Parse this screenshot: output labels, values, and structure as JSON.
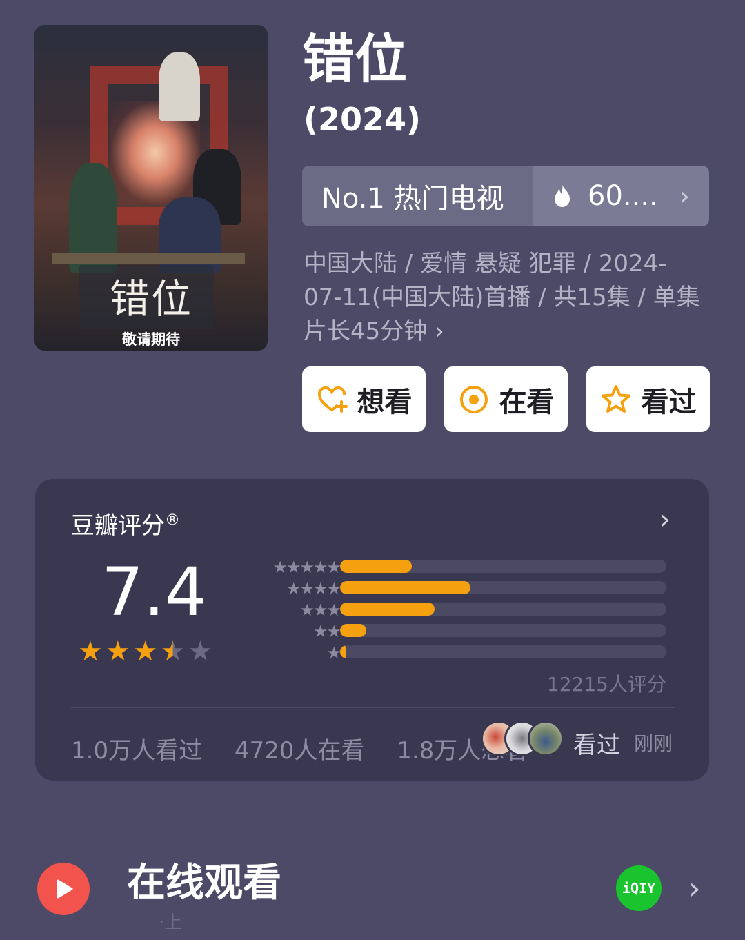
{
  "poster": {
    "title_text": "错位",
    "subtitle_text": "敬请期待"
  },
  "title": "错位",
  "year": "(2024)",
  "ranking": {
    "label": "No.1 热门电视",
    "heat": "60....",
    "heat_icon": "flame-icon"
  },
  "meta": {
    "text": "中国大陆 / 爱情 悬疑 犯罪 / 2024-07-11(中国大陆)首播 / 共15集 / 单集片长45分钟",
    "more": "›"
  },
  "actions": [
    {
      "label": "想看",
      "icon": "heart-plus-icon"
    },
    {
      "label": "在看",
      "icon": "target-icon"
    },
    {
      "label": "看过",
      "icon": "star-outline-icon"
    }
  ],
  "rating": {
    "label": "豆瓣评分",
    "registered": "®",
    "score": "7.4",
    "stars_filled": 3.5,
    "distribution": [
      {
        "stars": 5,
        "stars_text": "★★★★★",
        "percent": 22
      },
      {
        "stars": 4,
        "stars_text": "★★★★",
        "percent": 40
      },
      {
        "stars": 3,
        "stars_text": "★★★",
        "percent": 29
      },
      {
        "stars": 2,
        "stars_text": "★★",
        "percent": 8
      },
      {
        "stars": 1,
        "stars_text": "★",
        "percent": 2
      }
    ],
    "count": "12215人评分",
    "stats": [
      "1.0万人看过",
      "4720人在看",
      "1.8万人想看"
    ],
    "seen_label": "看过",
    "seen_time": "刚刚"
  },
  "online": {
    "title": "在线观看",
    "sub": "·上"
  },
  "colors": {
    "accent": "#f5a00f",
    "background": "#4c4a66",
    "card": "#393850",
    "play": "#f2534c",
    "iqiyi": "#19c42e"
  }
}
